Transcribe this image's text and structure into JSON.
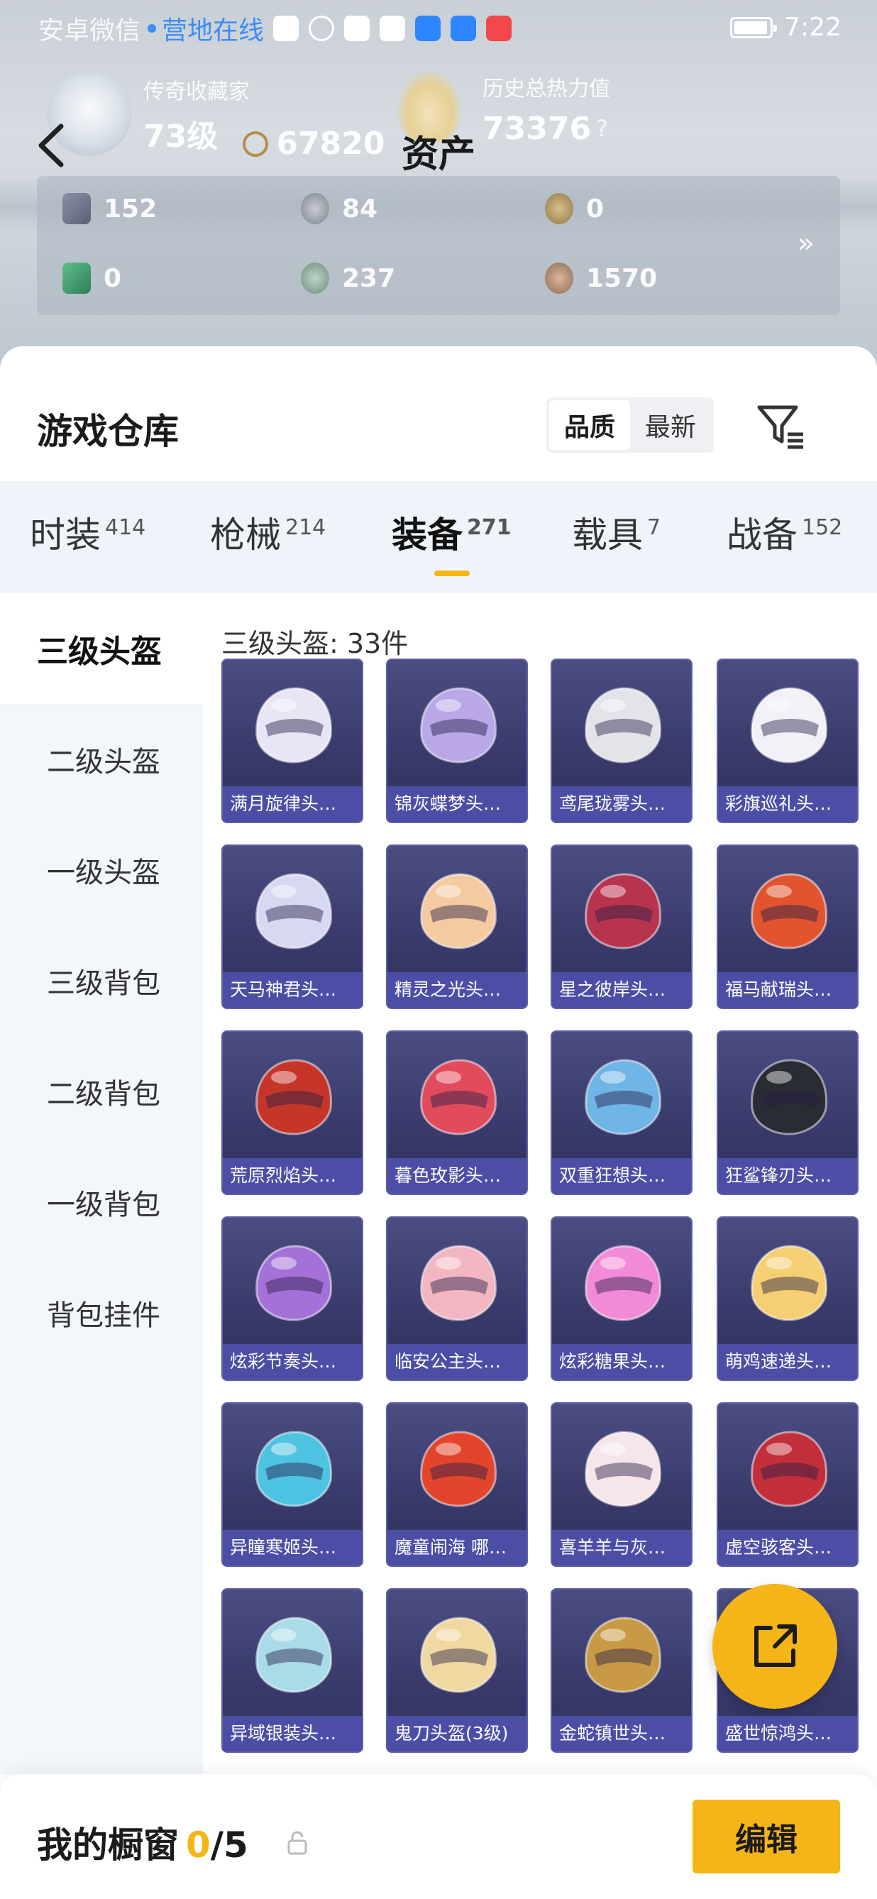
{
  "status_bar": {
    "left_text": "安卓微信",
    "camp_text": "营地在线",
    "time": "7:22",
    "icons": [
      "alert-icon",
      "wifi-icon",
      "mail-icon",
      "wechat-icon",
      "cloud-icon",
      "cloud-icon",
      "app-icon"
    ]
  },
  "profile": {
    "rank_title": "传奇收藏家",
    "level": "73级",
    "coins": "67820"
  },
  "header": {
    "title": "资产",
    "heat_label": "历史总热力值",
    "heat_value": "73376",
    "heat_help": "?"
  },
  "resources": [
    {
      "icon": "card-icon",
      "value": "152"
    },
    {
      "icon": "silver-coin-icon",
      "value": "84"
    },
    {
      "icon": "gold-coin-icon",
      "value": "0"
    },
    {
      "icon": "green-card-icon",
      "value": "0"
    },
    {
      "icon": "jade-coin-icon",
      "value": "237"
    },
    {
      "icon": "bronze-coin-icon",
      "value": "1570"
    }
  ],
  "resources_more": "»",
  "warehouse": {
    "title": "游戏仓库",
    "sort_options": [
      "品质",
      "最新"
    ],
    "sort_active": "品质"
  },
  "tabs": [
    {
      "label": "时装",
      "count": "414"
    },
    {
      "label": "枪械",
      "count": "214"
    },
    {
      "label": "装备",
      "count": "271"
    },
    {
      "label": "载具",
      "count": "7"
    },
    {
      "label": "战备",
      "count": "152"
    }
  ],
  "active_tab": "装备",
  "sidebar": {
    "items": [
      "三级头盔",
      "二级头盔",
      "一级头盔",
      "三级背包",
      "二级背包",
      "一级背包",
      "背包挂件"
    ],
    "active": "三级头盔"
  },
  "content": {
    "count_label": "三级头盔: 33件"
  },
  "items": [
    {
      "name": "满月旋律头…",
      "color": "#e8e6f4"
    },
    {
      "name": "锦灰蝶梦头…",
      "color": "#b9a7e8"
    },
    {
      "name": "鸢尾珑雾头…",
      "color": "#e3e3ea"
    },
    {
      "name": "彩旗巡礼头…",
      "color": "#f1f1f7"
    },
    {
      "name": "天马神君头…",
      "color": "#d7d9f2"
    },
    {
      "name": "精灵之光头…",
      "color": "#f4cba0"
    },
    {
      "name": "星之彼岸头…",
      "color": "#b8344e"
    },
    {
      "name": "福马献瑞头…",
      "color": "#e2542f"
    },
    {
      "name": "荒原烈焰头…",
      "color": "#c63628"
    },
    {
      "name": "暮色玫影头…",
      "color": "#e24b5c"
    },
    {
      "name": "双重狂想头…",
      "color": "#6fb5e6"
    },
    {
      "name": "狂鲨锋刃头…",
      "color": "#2a2c34"
    },
    {
      "name": "炫彩节奏头…",
      "color": "#a471d8"
    },
    {
      "name": "临安公主头…",
      "color": "#f2b7c2"
    },
    {
      "name": "炫彩糖果头…",
      "color": "#f28ad8"
    },
    {
      "name": "萌鸡速递头…",
      "color": "#f5cf72"
    },
    {
      "name": "异瞳寒姬头…",
      "color": "#4fc4e2"
    },
    {
      "name": "魔童闹海 哪…",
      "color": "#e2452c"
    },
    {
      "name": "喜羊羊与灰…",
      "color": "#f6e6ea"
    },
    {
      "name": "虚空骇客头…",
      "color": "#c22e3a"
    },
    {
      "name": "异域银装头…",
      "color": "#a9dbe8"
    },
    {
      "name": "鬼刀头盔(3级)",
      "color": "#efd9a0"
    },
    {
      "name": "金蛇镇世头…",
      "color": "#c99a45"
    },
    {
      "name": "盛世惊鸿头…",
      "color": "#f0ddc6"
    }
  ],
  "footer": {
    "label": "我的橱窗",
    "count": "0",
    "total": "/5",
    "edit_label": "编辑"
  }
}
